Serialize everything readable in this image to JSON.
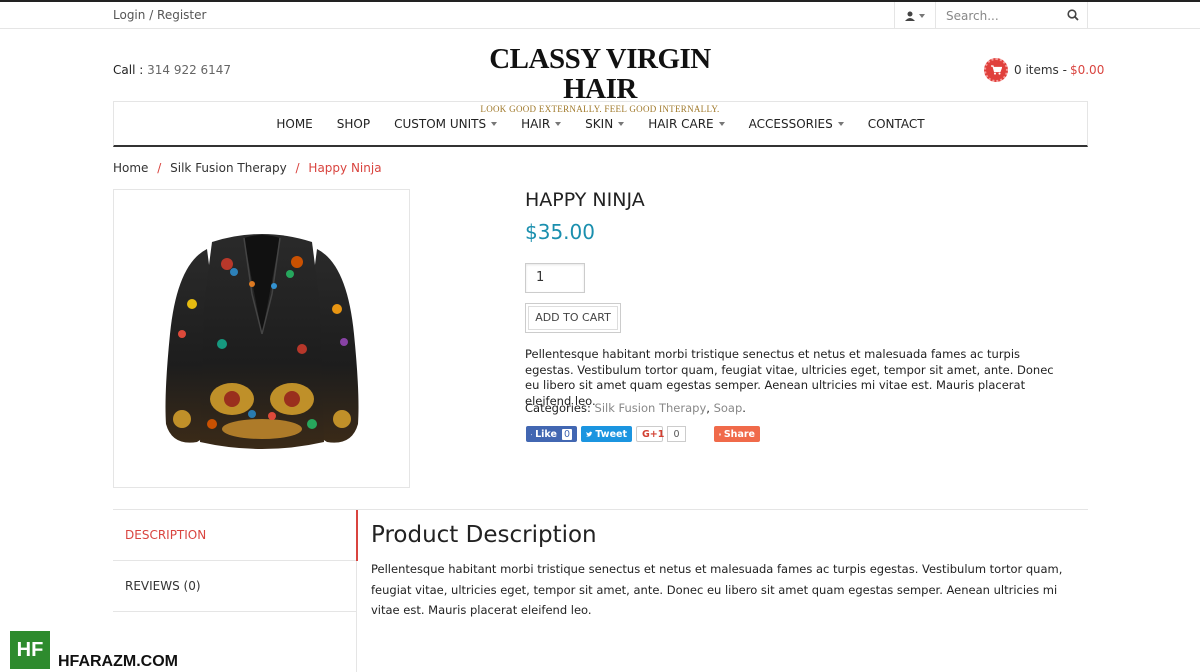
{
  "topbar": {
    "login_register": "Login / Register",
    "search_placeholder": "Search..."
  },
  "header": {
    "call_label": "Call :",
    "phone": "314 922 6147",
    "brand": "CLASSY VIRGIN HAIR",
    "tagline": "LOOK GOOD EXTERNALLY. FEEL GOOD INTERNALLY.",
    "cart_items": "0 items -",
    "cart_total": "$0.00"
  },
  "nav": {
    "home": "HOME",
    "shop": "SHOP",
    "custom_units": "CUSTOM UNITS",
    "hair": "HAIR",
    "skin": "SKIN",
    "hair_care": "HAIR CARE",
    "accessories": "ACCESSORIES",
    "contact": "CONTACT"
  },
  "breadcrumb": {
    "home": "Home",
    "sep": "/",
    "category": "Silk Fusion Therapy",
    "current": "Happy Ninja"
  },
  "product": {
    "title": "HAPPY NINJA",
    "price": "$35.00",
    "quantity": "1",
    "add_to_cart": "ADD TO CART",
    "short_description": "Pellentesque habitant morbi tristique senectus et netus et malesuada fames ac turpis egestas. Vestibulum tortor quam, feugiat vitae, ultricies eget, tempor sit amet, ante. Donec eu libero sit amet quam egestas semper. Aenean ultricies mi vitae est. Mauris placerat eleifend leo.",
    "categories_label": "Categories:",
    "category_1": "Silk Fusion Therapy",
    "comma": ",",
    "category_2": "Soap",
    "period": "."
  },
  "share": {
    "fb_like": "Like",
    "fb_count": "0",
    "tweet": "Tweet",
    "gplus": "G+1",
    "gplus_count": "0",
    "share": "Share"
  },
  "tabs": {
    "description": "DESCRIPTION",
    "reviews": "REVIEWS (0)"
  },
  "description": {
    "heading": "Product Description",
    "text": "Pellentesque habitant morbi tristique senectus et netus et malesuada fames ac turpis egestas. Vestibulum tortor quam, feugiat vitae, ultricies eget, tempor sit amet, ante. Donec eu libero sit amet quam egestas semper. Aenean ultricies mi vitae est. Mauris placerat eleifend leo."
  },
  "watermark": {
    "logo": "HF",
    "site": "HFARAZM.COM"
  },
  "colors": {
    "accent_red": "#d9443f",
    "price_blue": "#1a8fae",
    "tagline_gold": "#a0792a"
  }
}
